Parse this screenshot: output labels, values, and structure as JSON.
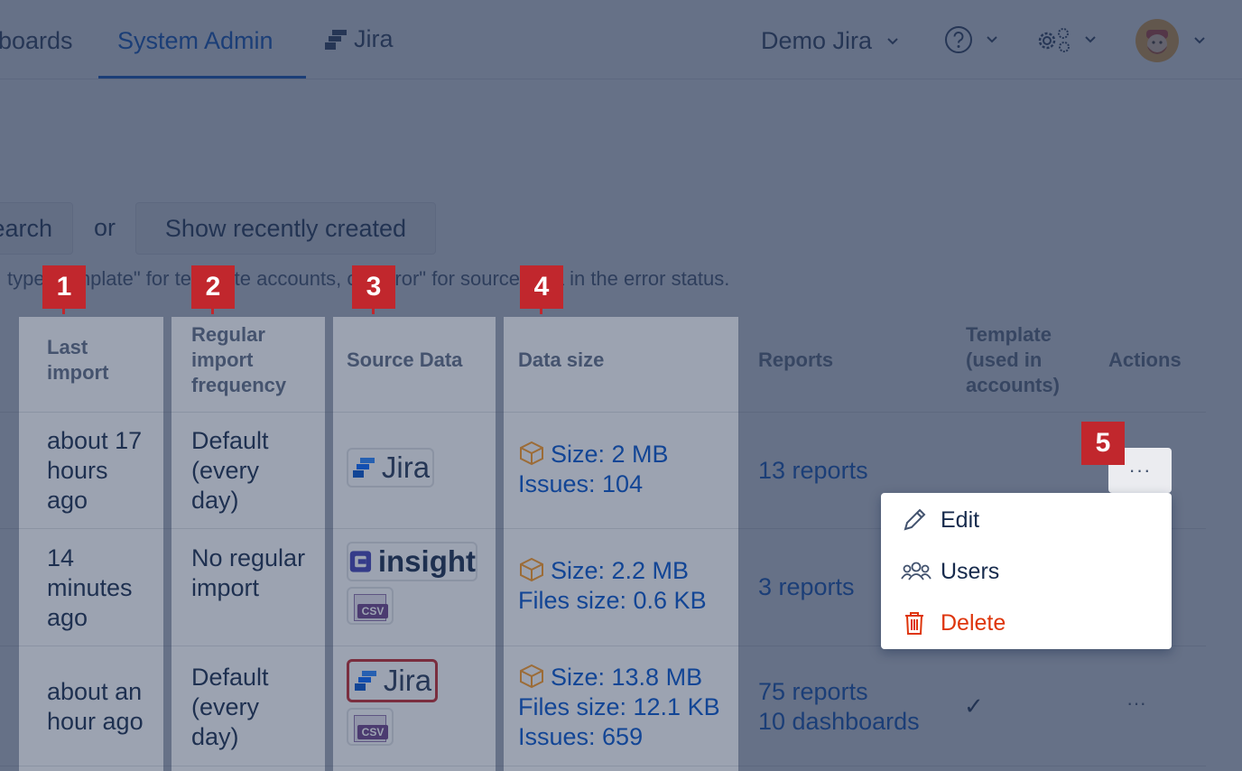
{
  "nav": {
    "dashboards_label": "boards",
    "system_admin_label": "System Admin",
    "jira_logo_text": "Jira",
    "account_label": "Demo Jira"
  },
  "search": {
    "search_button_label": "earch",
    "or_label": "or",
    "show_recent_label": "Show recently created",
    "hint_text": "type \"template\" for template accounts, or \"error\" for source data in the error status."
  },
  "badges": [
    "1",
    "2",
    "3",
    "4",
    "5"
  ],
  "table": {
    "headers": {
      "last_import": "Last import",
      "frequency": "Regular import frequency",
      "source_data": "Source Data",
      "data_size": "Data size",
      "reports": "Reports",
      "template": "Template (used in accounts)",
      "actions": "Actions"
    },
    "rows": [
      {
        "last_import": "about 17 hours ago",
        "frequency": "Default (every day)",
        "sources": [
          "Jira"
        ],
        "data_size": [
          "Size: 2 MB",
          "Issues: 104"
        ],
        "reports": [
          "13 reports"
        ],
        "template": ""
      },
      {
        "last_import": "14 minutes ago",
        "frequency": "No regular import",
        "sources": [
          "insight",
          "CSV"
        ],
        "data_size": [
          "Size: 2.2 MB",
          "Files size: 0.6 KB"
        ],
        "reports": [
          "3 reports"
        ],
        "template": ""
      },
      {
        "last_import": "about an hour ago",
        "frequency": "Default (every day)",
        "sources": [
          "Jira",
          "CSV"
        ],
        "data_size": [
          "Size: 13.8 MB",
          "Files size: 12.1 KB",
          "Issues: 659"
        ],
        "reports": [
          "75 reports",
          "10 dashboards"
        ],
        "template": "✓"
      }
    ]
  },
  "actions_menu": {
    "trigger_label": "···",
    "items": [
      {
        "label": "Edit",
        "icon": "pencil-icon"
      },
      {
        "label": "Users",
        "icon": "users-icon"
      },
      {
        "label": "Delete",
        "icon": "trash-icon",
        "color": "#de350b"
      }
    ]
  },
  "colors": {
    "accent": "#0052cc",
    "badge": "#c1272d",
    "danger": "#de350b",
    "package_icon": "#ff991f"
  }
}
